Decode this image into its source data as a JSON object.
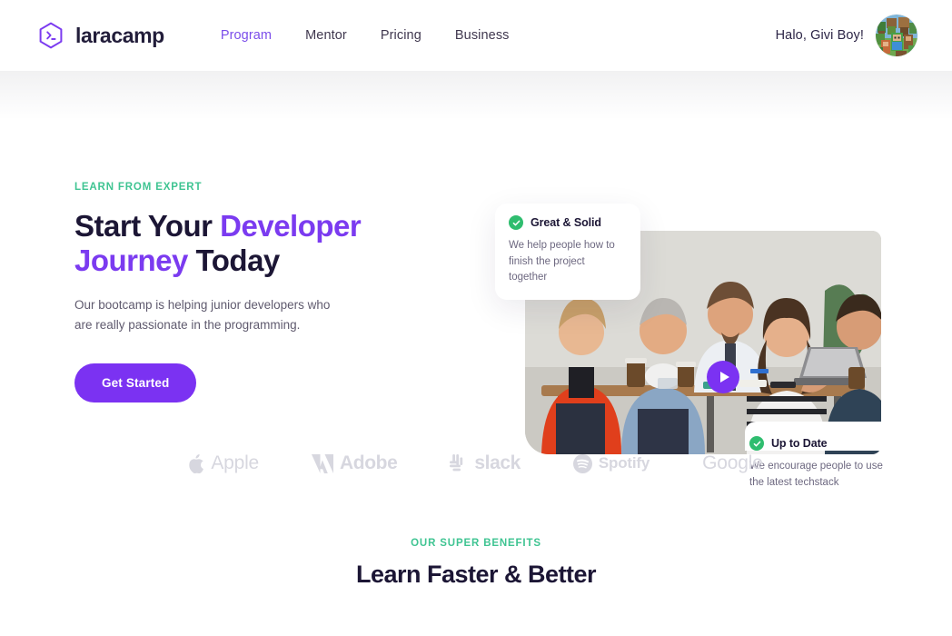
{
  "header": {
    "logo_icon": "hexagon-terminal-icon",
    "brand_name": "laracamp",
    "nav": [
      {
        "label": "Program",
        "active": true
      },
      {
        "label": "Mentor",
        "active": false
      },
      {
        "label": "Pricing",
        "active": false
      },
      {
        "label": "Business",
        "active": false
      }
    ],
    "greeting": "Halo, Givi Boy!",
    "avatar_icon": "user-avatar"
  },
  "hero": {
    "eyebrow": "LEARN FROM EXPERT",
    "title_part1": "Start Your ",
    "title_highlight1": "Developer",
    "title_part2": " ",
    "title_highlight2": "Journey",
    "title_part3": " Today",
    "subtitle": "Our bootcamp is helping junior developers who are really passionate in the programming.",
    "cta_label": "Get Started",
    "play_icon": "play-icon",
    "photo_alt": "team-meeting-photo",
    "cards": [
      {
        "icon": "check-circle-icon",
        "title": "Great & Solid",
        "body": "We help people how to finish the project together"
      },
      {
        "icon": "check-circle-icon",
        "title": "Up to Date",
        "body": "We encourage people to use the latest techstack"
      }
    ]
  },
  "brands": [
    {
      "label": "Apple",
      "icon": "apple-logo-icon"
    },
    {
      "label": "Adobe",
      "icon": "adobe-logo-icon"
    },
    {
      "label": "slack",
      "icon": "slack-logo-icon"
    },
    {
      "label": "Spotify",
      "icon": "spotify-logo-icon"
    },
    {
      "label": "Google",
      "icon": "google-logo-icon"
    }
  ],
  "benefits": {
    "eyebrow": "OUR SUPER BENEFITS",
    "title": "Learn Faster & Better"
  },
  "colors": {
    "purple": "#7b32f2",
    "purple_text": "#7b3bf0",
    "green": "#3fc492",
    "check_green": "#2fbd6f",
    "dark": "#1c1635",
    "muted": "#5f5a6e",
    "brand_gray": "#d7d7df"
  }
}
